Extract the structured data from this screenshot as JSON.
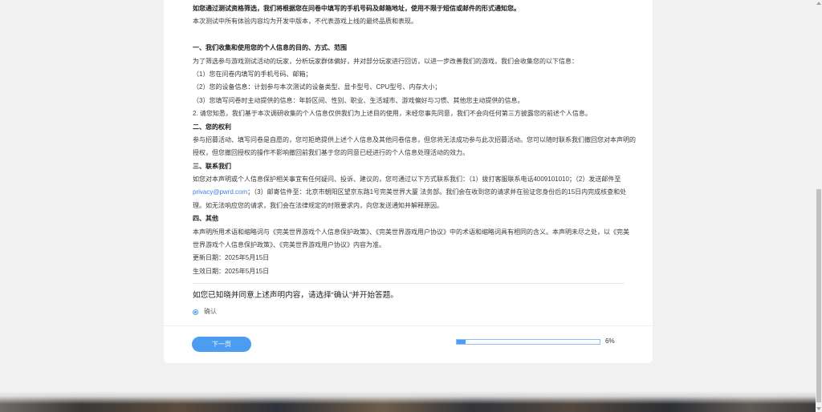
{
  "theme": {
    "accent": "#4c9cf1",
    "link": "#3c7fd9"
  },
  "statement": {
    "intro": [
      "如您通过测试资格筛选，我们将根据您在问卷中填写的手机号码及邮箱地址，使用不限于短信或邮件的形式通知您。",
      "本次测试中所有体验内容均为开发中版本，不代表游戏上线的最终品质和表现。"
    ],
    "sections": [
      {
        "heading": "一、我们收集和使用您的个人信息的目的、方式、范围",
        "lines": [
          "为了筛选参与游戏测试活动的玩家，分析玩家群体偏好，并对部分玩家进行回访，以进一步改善我们的游戏，我们会收集您的以下信息：",
          "（1）您在问卷内填写的手机号码、邮箱；",
          "（2）您的设备信息：计划参与本次测试的设备类型、显卡型号、CPU型号、内存大小；",
          "（3）您填写问卷时主动提供的信息：年龄区间、性别、职业、生活城市、游戏偏好与习惯、其他您主动提供的信息。",
          "2. 请您知悉，我们基于本次调研收集的个人信息仅供我们为上述目的使用，未经您事先同意，我们不会向任何第三方披露您的前述个人信息。"
        ]
      },
      {
        "heading": "二、您的权利",
        "lines": [
          "参与招募活动、填写问卷是自愿的，您可拒绝提供上述个人信息及其他问卷信息，但您将无法成功参与此次招募活动。您可以随时联系我们撤回您对本声明的",
          "授权，但您撤回授权的操作不影响撤回前我们基于您的同意已经进行的个人信息处理活动的效力。"
        ]
      },
      {
        "heading": "三、联系我们",
        "lines": [
          "如您对本声明或个人信息保护相关事宜有任何疑问、投诉、建议的，您可通过以下方式联系我们：（1）拨打客服联系电话4009101010；（2）发送邮件至",
          {
            "link": "privacy@pwrd.com",
            "text": "；（3）邮寄信件至：北京市朝阳区望京东路1号完美世界大厦 法务部。我们会在收到您的请求并在验证您身份后的15日内完成核查和处"
          },
          "理。如无法响应您的请求，我们会在法律规定的时限要求内，向您发送通知并解释原因。"
        ]
      },
      {
        "heading": "四、其他",
        "lines": [
          "本声明所用术语和缩略词与《完美世界游戏个人信息保护政策》、《完美世界游戏用户协议》中的术语和缩略词具有相同的含义。本声明未尽之处，以《完美",
          "世界游戏个人信息保护政策》、《完美世界游戏用户协议》内容为准。",
          "更新日期：2025年5月15日",
          "生效日期：2025年5月15日"
        ]
      }
    ]
  },
  "question": {
    "text": "如您已知晓并同意上述声明内容，请选择“确认”并开始答题。",
    "options": [
      {
        "label": "确认",
        "selected": true
      }
    ]
  },
  "footer": {
    "next_button": "下一页",
    "progress": {
      "value": 0.06,
      "label": "6%"
    }
  },
  "scrollbar": {
    "up_icon": "chevron-up-icon",
    "down_icon": "chevron-down-icon"
  }
}
